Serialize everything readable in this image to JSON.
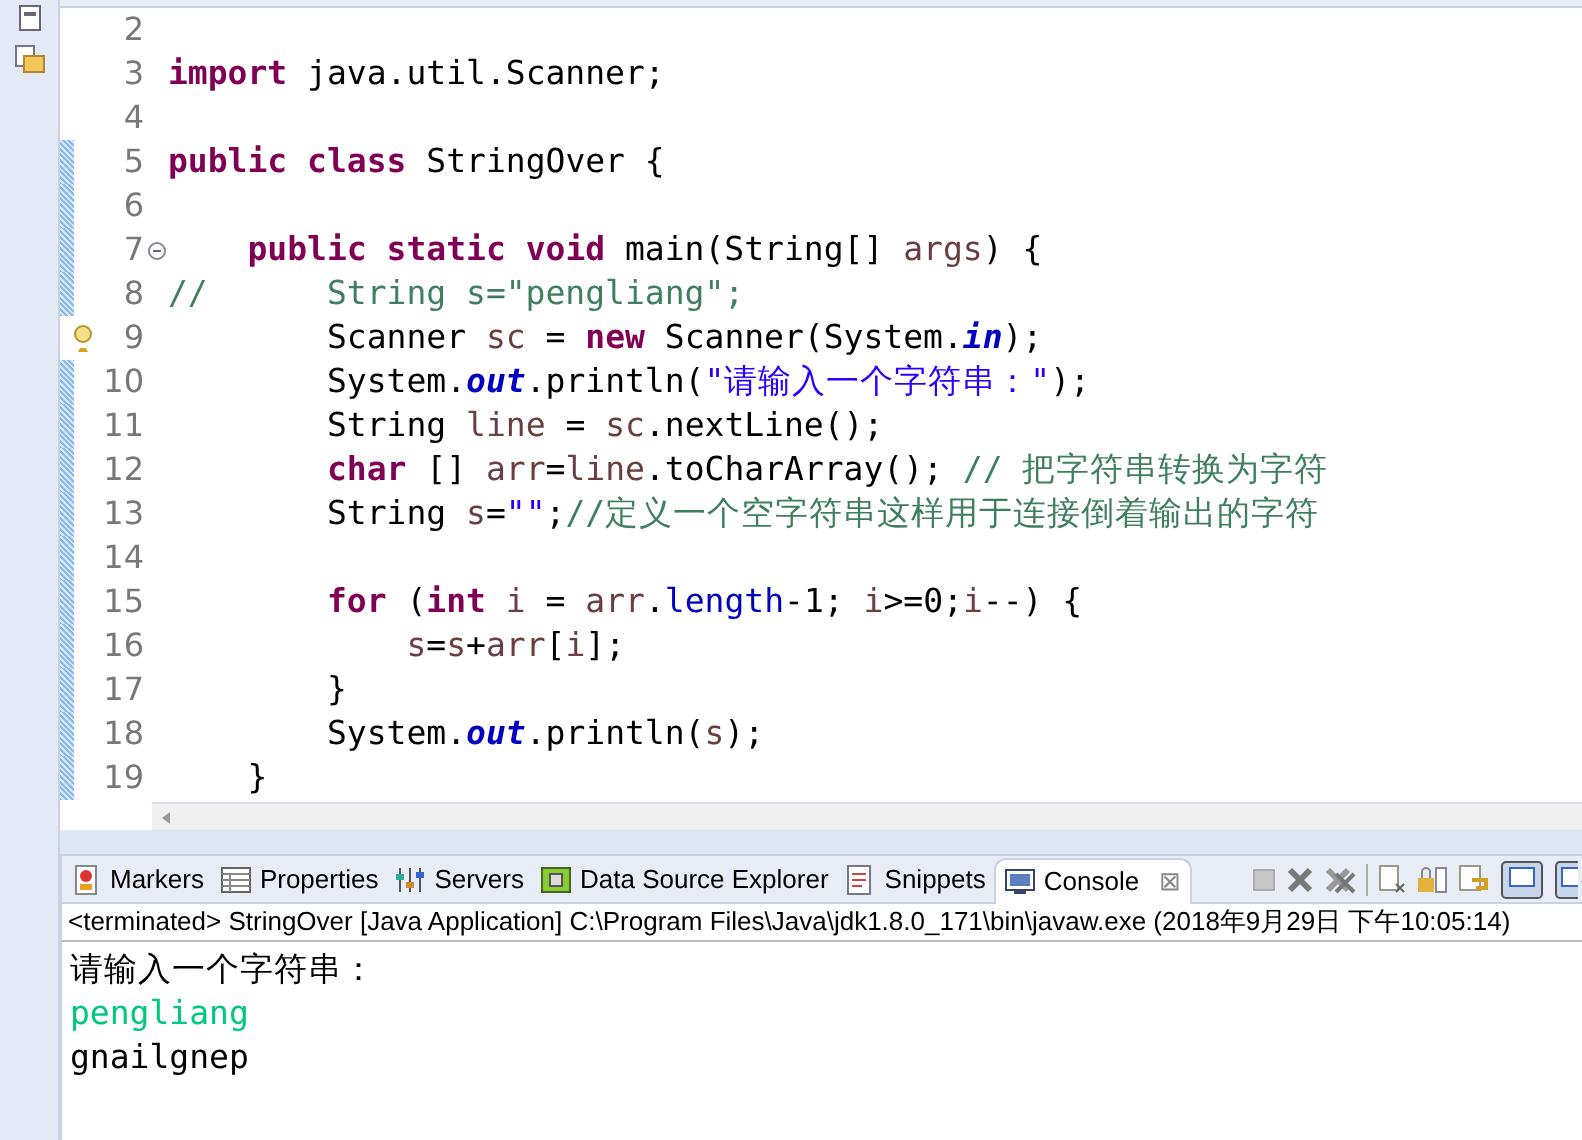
{
  "editor": {
    "lines": [
      {
        "number": "2",
        "changed": false,
        "fold": false,
        "warning": false
      },
      {
        "number": "3",
        "changed": false,
        "fold": false,
        "warning": false,
        "tokens": [
          {
            "kind": "keyword",
            "text": "import"
          },
          {
            "kind": "plain",
            "text": " java.util.Scanner;"
          }
        ]
      },
      {
        "number": "4",
        "changed": false,
        "fold": false,
        "warning": false
      },
      {
        "number": "5",
        "changed": true,
        "fold": false,
        "warning": false,
        "tokens": [
          {
            "kind": "keyword",
            "text": "public"
          },
          {
            "kind": "keyword",
            "text": " class"
          },
          {
            "kind": "plain",
            "text": " StringOver {"
          }
        ]
      },
      {
        "number": "6",
        "changed": true,
        "fold": false,
        "warning": false
      },
      {
        "number": "7",
        "changed": true,
        "fold": true,
        "warning": false,
        "tokens": [
          {
            "kind": "keyword",
            "text": "    public"
          },
          {
            "kind": "keyword",
            "text": " static"
          },
          {
            "kind": "keyword",
            "text": " void"
          },
          {
            "kind": "plain",
            "text": " main(String[] "
          },
          {
            "kind": "local",
            "text": "args"
          },
          {
            "kind": "plain",
            "text": ") {"
          }
        ]
      },
      {
        "number": "8",
        "changed": true,
        "fold": false,
        "warning": false,
        "tokens": [
          {
            "kind": "comment",
            "text": "//      String s=\"pengliang\";"
          }
        ]
      },
      {
        "number": "9",
        "changed": false,
        "fold": false,
        "warning": true,
        "tokens": [
          {
            "kind": "plain",
            "text": "        Scanner "
          },
          {
            "kind": "local",
            "text": "sc"
          },
          {
            "kind": "plain",
            "text": " = "
          },
          {
            "kind": "keyword",
            "text": "new"
          },
          {
            "kind": "plain",
            "text": " Scanner(System."
          },
          {
            "kind": "static",
            "text": "in"
          },
          {
            "kind": "plain",
            "text": ");"
          }
        ]
      },
      {
        "number": "10",
        "changed": true,
        "fold": false,
        "warning": false,
        "tokens": [
          {
            "kind": "plain",
            "text": "        System."
          },
          {
            "kind": "static",
            "text": "out"
          },
          {
            "kind": "plain",
            "text": ".println("
          },
          {
            "kind": "string",
            "text": "\"请输入一个字符串：\""
          },
          {
            "kind": "plain",
            "text": ");"
          }
        ]
      },
      {
        "number": "11",
        "changed": true,
        "fold": false,
        "warning": false,
        "tokens": [
          {
            "kind": "plain",
            "text": "        String "
          },
          {
            "kind": "local",
            "text": "line"
          },
          {
            "kind": "plain",
            "text": " = "
          },
          {
            "kind": "local",
            "text": "sc"
          },
          {
            "kind": "plain",
            "text": ".nextLine();"
          }
        ]
      },
      {
        "number": "12",
        "changed": true,
        "fold": false,
        "warning": false,
        "tokens": [
          {
            "kind": "keyword",
            "text": "        char"
          },
          {
            "kind": "plain",
            "text": " [] "
          },
          {
            "kind": "local",
            "text": "arr"
          },
          {
            "kind": "plain",
            "text": "="
          },
          {
            "kind": "local",
            "text": "line"
          },
          {
            "kind": "plain",
            "text": ".toCharArray(); "
          },
          {
            "kind": "comment",
            "text": "// 把字符串转换为字符"
          }
        ]
      },
      {
        "number": "13",
        "changed": true,
        "fold": false,
        "warning": false,
        "tokens": [
          {
            "kind": "plain",
            "text": "        String "
          },
          {
            "kind": "local",
            "text": "s"
          },
          {
            "kind": "plain",
            "text": "="
          },
          {
            "kind": "string",
            "text": "\"\""
          },
          {
            "kind": "plain",
            "text": ";"
          },
          {
            "kind": "comment",
            "text": "//定义一个空字符串这样用于连接倒着输出的字符"
          }
        ]
      },
      {
        "number": "14",
        "changed": true,
        "fold": false,
        "warning": false
      },
      {
        "number": "15",
        "changed": true,
        "fold": false,
        "warning": false,
        "tokens": [
          {
            "kind": "keyword",
            "text": "        for"
          },
          {
            "kind": "plain",
            "text": " ("
          },
          {
            "kind": "keyword",
            "text": "int"
          },
          {
            "kind": "local",
            "text": " i"
          },
          {
            "kind": "plain",
            "text": " = "
          },
          {
            "kind": "local",
            "text": "arr"
          },
          {
            "kind": "plain",
            "text": "."
          },
          {
            "kind": "field",
            "text": "length"
          },
          {
            "kind": "plain",
            "text": "-1; "
          },
          {
            "kind": "local",
            "text": "i"
          },
          {
            "kind": "plain",
            "text": ">=0;"
          },
          {
            "kind": "local",
            "text": "i"
          },
          {
            "kind": "plain",
            "text": "--) {"
          }
        ]
      },
      {
        "number": "16",
        "changed": true,
        "fold": false,
        "warning": false,
        "tokens": [
          {
            "kind": "local",
            "text": "            s"
          },
          {
            "kind": "plain",
            "text": "="
          },
          {
            "kind": "local",
            "text": "s"
          },
          {
            "kind": "plain",
            "text": "+"
          },
          {
            "kind": "local",
            "text": "arr"
          },
          {
            "kind": "plain",
            "text": "["
          },
          {
            "kind": "local",
            "text": "i"
          },
          {
            "kind": "plain",
            "text": "];"
          }
        ]
      },
      {
        "number": "17",
        "changed": true,
        "fold": false,
        "warning": false,
        "tokens": [
          {
            "kind": "plain",
            "text": "        }"
          }
        ]
      },
      {
        "number": "18",
        "changed": true,
        "fold": false,
        "warning": false,
        "tokens": [
          {
            "kind": "plain",
            "text": "        System."
          },
          {
            "kind": "static",
            "text": "out"
          },
          {
            "kind": "plain",
            "text": ".println("
          },
          {
            "kind": "local",
            "text": "s"
          },
          {
            "kind": "plain",
            "text": ");"
          }
        ]
      },
      {
        "number": "19",
        "changed": true,
        "fold": false,
        "warning": false,
        "tokens": [
          {
            "kind": "plain",
            "text": "    }"
          }
        ]
      }
    ]
  },
  "views": {
    "tabs": [
      {
        "label": "Markers",
        "selected": false
      },
      {
        "label": "Properties",
        "selected": false
      },
      {
        "label": "Servers",
        "selected": false
      },
      {
        "label": "Data Source Explorer",
        "selected": false
      },
      {
        "label": "Snippets",
        "selected": false
      },
      {
        "label": "Console",
        "selected": true,
        "close": "⊠"
      }
    ]
  },
  "console": {
    "header": "<terminated> StringOver [Java Application] C:\\Program Files\\Java\\jdk1.8.0_171\\bin\\javaw.exe (2018年9月29日 下午10:05:14)",
    "lines": [
      {
        "kind": "output",
        "text": "请输入一个字符串："
      },
      {
        "kind": "input",
        "text": "pengliang"
      },
      {
        "kind": "output",
        "text": "gnailgnep"
      }
    ]
  }
}
